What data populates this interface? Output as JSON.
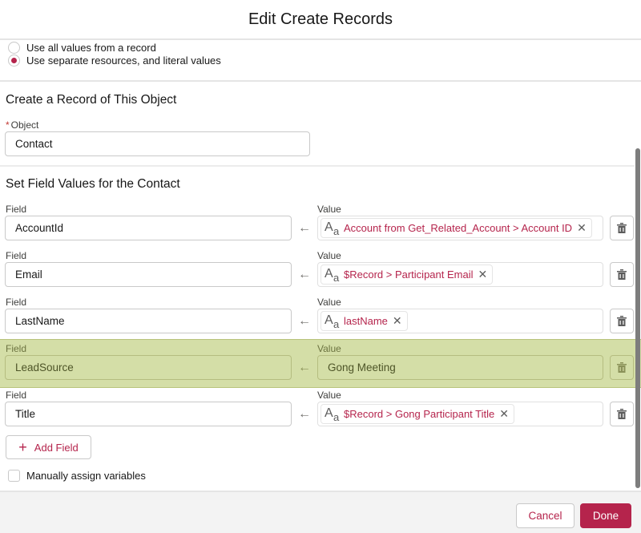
{
  "header": {
    "title": "Edit Create Records"
  },
  "record_options": [
    {
      "label": "Use all values from a record",
      "checked": false
    },
    {
      "label": "Use separate resources, and literal values",
      "checked": true
    }
  ],
  "object_section": {
    "title": "Create a Record of This Object",
    "object_label": "Object",
    "required_marker": "*",
    "object_value": "Contact"
  },
  "fields_section": {
    "title": "Set Field Values for the Contact",
    "field_label": "Field",
    "value_label": "Value",
    "rows": [
      {
        "field": "AccountId",
        "value": "Account from Get_Related_Account > Account ID",
        "type": "resource",
        "highlighted": false
      },
      {
        "field": "Email",
        "value": "$Record > Participant Email",
        "type": "resource",
        "highlighted": false
      },
      {
        "field": "LastName",
        "value": "lastName",
        "type": "resource",
        "highlighted": false
      },
      {
        "field": "LeadSource",
        "value": "Gong Meeting",
        "type": "literal",
        "highlighted": true
      },
      {
        "field": "Title",
        "value": "$Record > Gong Participant Title",
        "type": "resource",
        "highlighted": false
      }
    ],
    "add_field_label": "Add Field",
    "manual_assign_label": "Manually assign variables",
    "manual_assign_checked": false
  },
  "icons": {
    "arrow": "←",
    "resource_type": "text-resource-icon",
    "remove": "✕",
    "delete": "trash-icon",
    "add": "+"
  },
  "footer": {
    "cancel_label": "Cancel",
    "done_label": "Done"
  },
  "colors": {
    "accent": "#b5244c",
    "highlight": "#c9d38f"
  }
}
